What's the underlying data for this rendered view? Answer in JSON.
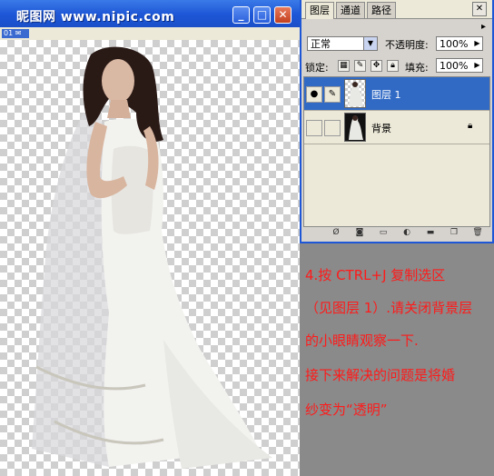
{
  "document": {
    "title": "昵图网 www.nipic.com",
    "sub_label": "01"
  },
  "layers_panel": {
    "tabs": [
      "图层",
      "通道",
      "路径"
    ],
    "blend_mode": "正常",
    "opacity_label": "不透明度:",
    "opacity_value": "100%",
    "lock_label": "锁定:",
    "fill_label": "填充:",
    "fill_value": "100%",
    "layers": [
      {
        "name": "图层 1",
        "selected": true,
        "visible": true
      },
      {
        "name": "背景",
        "selected": false,
        "visible": false,
        "locked": true
      }
    ]
  },
  "note": {
    "lines": [
      "4.按 CTRL+J 复制选区",
      "（见图层 1）.请关闭背景层",
      "的小眼睛观察一下.",
      "接下来解决的问题是将婚",
      "纱变为“透明”"
    ]
  },
  "colors": {
    "titlebar": "#1d56d6",
    "selection": "#316ac5",
    "note_text": "#ff1a1a",
    "note_bg": "#8a8a8a"
  }
}
